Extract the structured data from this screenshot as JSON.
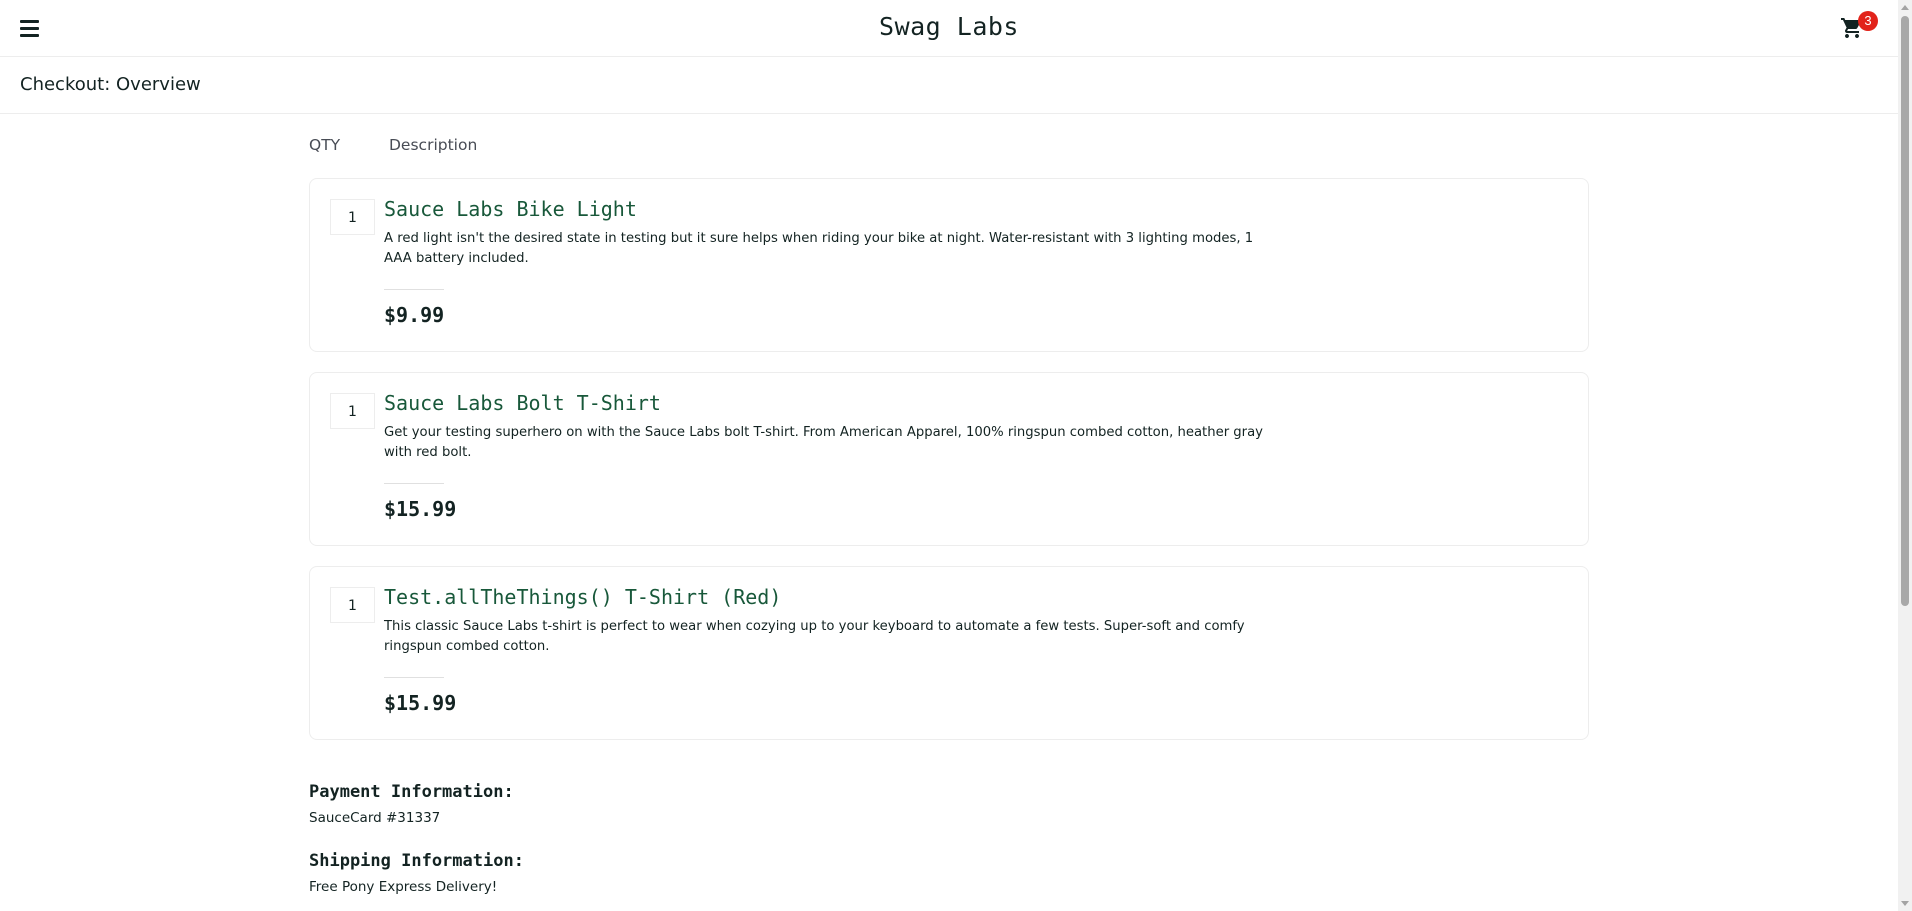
{
  "header": {
    "logo_text": "Swag Labs",
    "menu_icon": "hamburger-menu-icon",
    "cart_icon": "shopping-cart-icon",
    "cart_badge": "3"
  },
  "page": {
    "title": "Checkout: Overview"
  },
  "cart": {
    "qty_label": "QTY",
    "desc_label": "Description",
    "items": [
      {
        "qty": "1",
        "name": "Sauce Labs Bike Light",
        "description": "A red light isn't the desired state in testing but it sure helps when riding your bike at night. Water-resistant with 3 lighting modes, 1 AAA battery included.",
        "price": "$9.99"
      },
      {
        "qty": "1",
        "name": "Sauce Labs Bolt T-Shirt",
        "description": "Get your testing superhero on with the Sauce Labs bolt T-shirt. From American Apparel, 100% ringspun combed cotton, heather gray with red bolt.",
        "price": "$15.99"
      },
      {
        "qty": "1",
        "name": "Test.allTheThings() T-Shirt (Red)",
        "description": "This classic Sauce Labs t-shirt is perfect to wear when cozying up to your keyboard to automate a few tests. Super-soft and comfy ringspun combed cotton.",
        "price": "$15.99"
      }
    ]
  },
  "summary": {
    "payment_label": "Payment Information:",
    "payment_value": "SauceCard #31337",
    "shipping_label": "Shipping Information:",
    "shipping_value": "Free Pony Express Delivery!"
  },
  "colors": {
    "item_name": "#18583a",
    "badge": "#e2231a",
    "text": "#132322",
    "border": "#ededed"
  }
}
